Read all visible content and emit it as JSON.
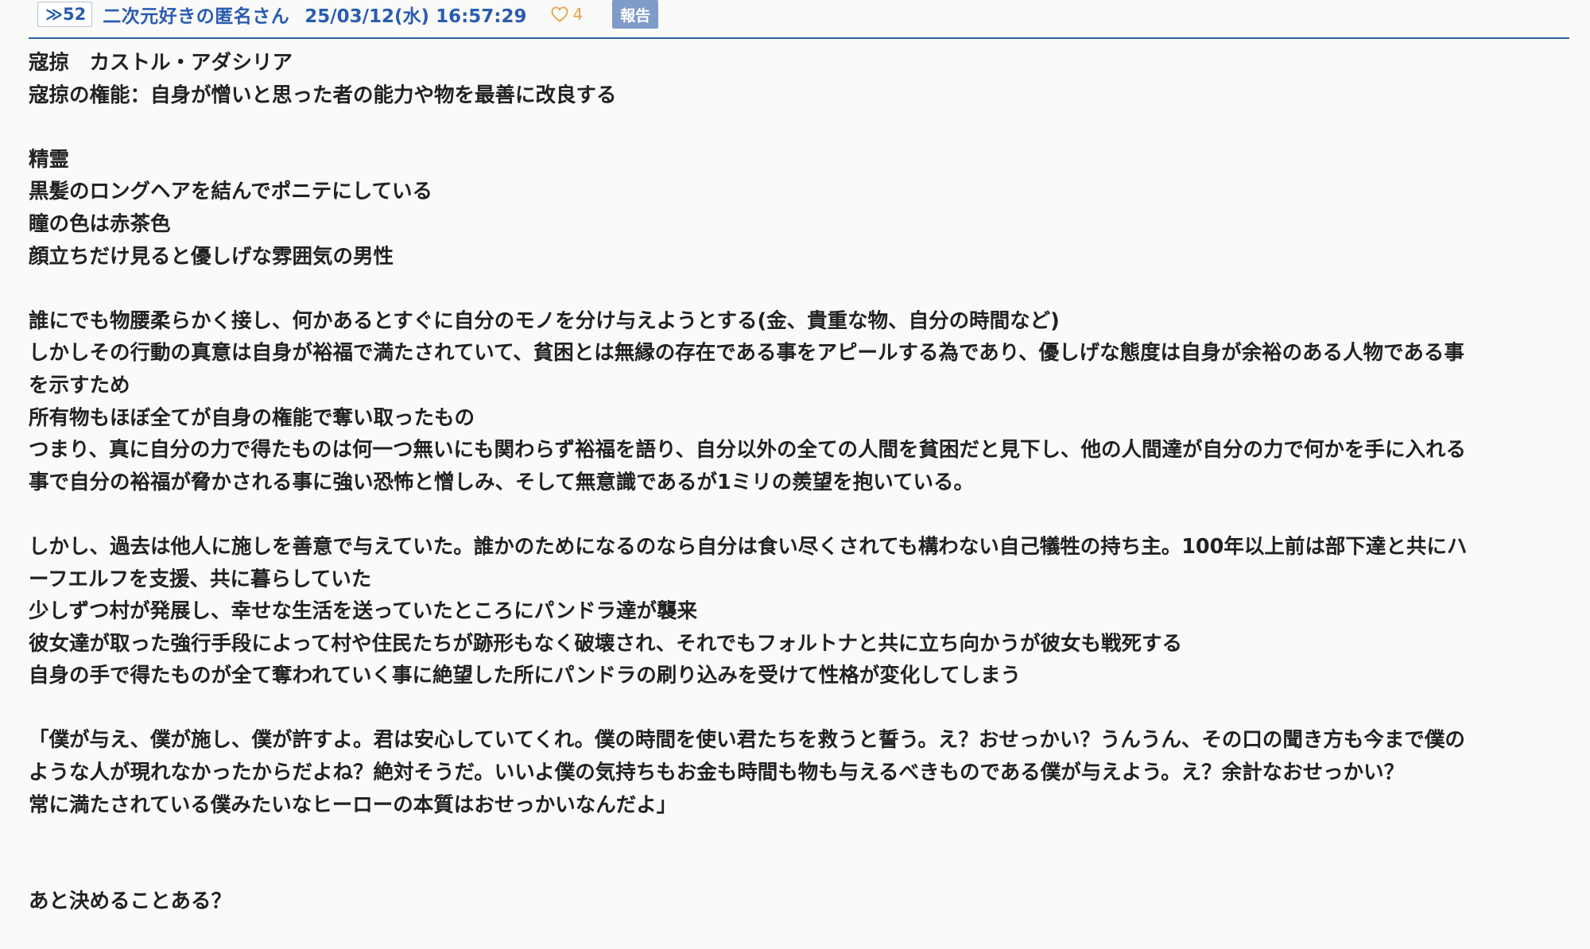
{
  "post": {
    "number_label": "≫52",
    "poster_name": "二次元好きの匿名さん",
    "date": "25/03/12(水) 16:57:29",
    "like_count": "4",
    "report_label": "報告",
    "accent_color": "#2a5db0",
    "like_color": "#e3a64a",
    "report_button_color": "#7f9bc9"
  },
  "body_lines": [
    "寇掠　カストル・アダシリア",
    "寇掠の権能：自身が憎いと思った者の能力や物を最善に改良する",
    "",
    "精霊",
    "黒髪のロングヘアを結んでポニテにしている",
    "瞳の色は赤茶色",
    "顔立ちだけ見ると優しげな雰囲気の男性",
    "",
    "誰にでも物腰柔らかく接し、何かあるとすぐに自分のモノを分け与えようとする(金、貴重な物、自分の時間など)",
    "しかしその行動の真意は自身が裕福で満たされていて、貧困とは無縁の存在である事をアピールする為であり、優しげな態度は自身が余裕のある人物である事",
    "を示すため",
    "所有物もほぼ全てが自身の権能で奪い取ったもの",
    "つまり、真に自分の力で得たものは何一つ無いにも関わらず裕福を語り、自分以外の全ての人間を貧困だと見下し、他の人間達が自分の力で何かを手に入れる",
    "事で自分の裕福が脅かされる事に強い恐怖と憎しみ、そして無意識であるが1ミリの羨望を抱いている。",
    "",
    "しかし、過去は他人に施しを善意で与えていた。誰かのためになるのなら自分は食い尽くされても構わない自己犠牲の持ち主。100年以上前は部下達と共にハ",
    "ーフエルフを支援、共に暮らしていた",
    "少しずつ村が発展し、幸せな生活を送っていたところにパンドラ達が襲来",
    "彼女達が取った強行手段によって村や住民たちが跡形もなく破壊され、それでもフォルトナと共に立ち向かうが彼女も戦死する",
    "自身の手で得たものが全て奪われていく事に絶望した所にパンドラの刷り込みを受けて性格が変化してしまう",
    "",
    "「僕が与え、僕が施し、僕が許すよ。君は安心していてくれ。僕の時間を使い君たちを救うと誓う。え？おせっかい？うんうん、その口の聞き方も今まで僕の",
    "ような人が現れなかったからだよね？絶対そうだ。いいよ僕の気持ちもお金も時間も物も与えるべきものである僕が与えよう。え？余計なおせっかい？",
    "常に満たされている僕みたいなヒーローの本質はおせっかいなんだよ」",
    "",
    "",
    "あと決めることある？"
  ]
}
